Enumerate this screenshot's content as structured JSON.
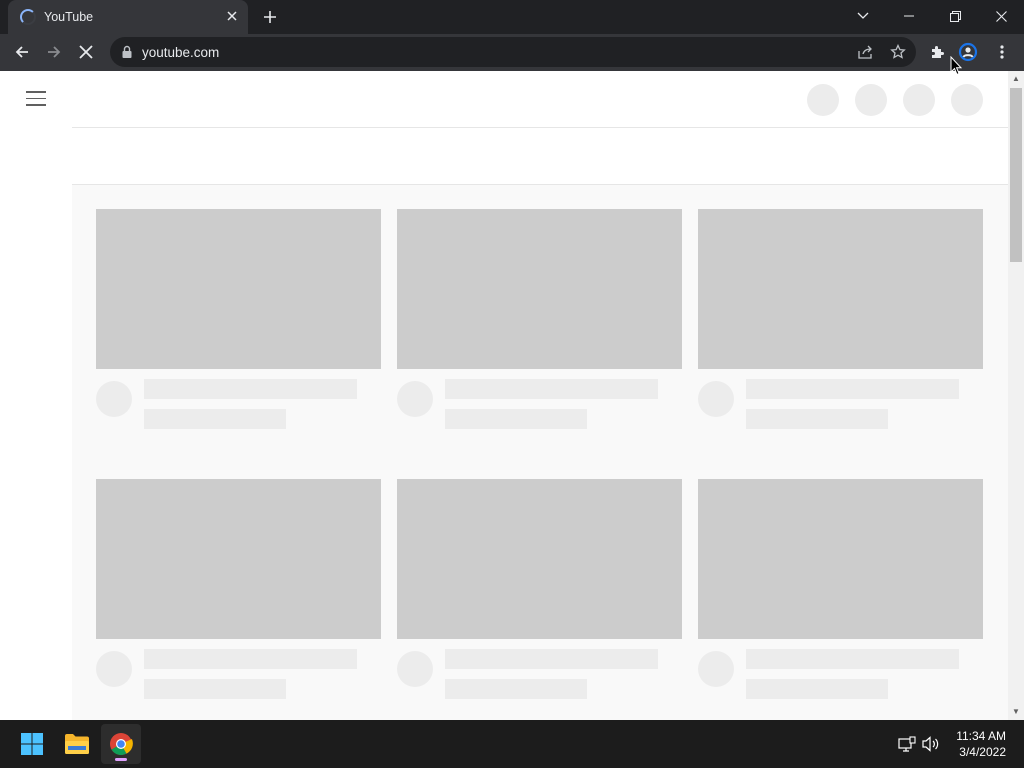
{
  "browser": {
    "tab": {
      "title": "YouTube",
      "close_icon": "close-icon",
      "loading_icon": "spinner-icon"
    },
    "new_tab_icon": "plus-icon",
    "window_controls": [
      "tab-search-icon",
      "minimize-icon",
      "restore-icon",
      "close-icon"
    ],
    "toolbar": {
      "back_icon": "arrow-left-icon",
      "forward_icon": "arrow-right-icon",
      "stop_icon": "close-icon",
      "url": "youtube.com",
      "lock_icon": "lock-icon",
      "share_icon": "share-icon",
      "bookmark_icon": "star-icon",
      "extensions_icon": "puzzle-icon",
      "profile_icon": "avatar-icon",
      "menu_icon": "kebab-menu-icon"
    }
  },
  "page": {
    "site": "YouTube",
    "state": "loading-skeleton",
    "header_placeholders": 4,
    "rows": [
      {
        "cards": 3
      },
      {
        "cards": 3
      }
    ]
  },
  "taskbar": {
    "apps": [
      {
        "name": "start",
        "icon": "windows-logo-icon"
      },
      {
        "name": "file-explorer",
        "icon": "folder-icon"
      },
      {
        "name": "chrome",
        "icon": "chrome-icon",
        "active": true
      }
    ],
    "tray": [
      "network-icon",
      "volume-icon"
    ],
    "time": "11:34 AM",
    "date": "3/4/2022"
  },
  "colors": {
    "chrome_dark": "#202124",
    "chrome_toolbar": "#35363a",
    "skeleton_thumb": "#cccccc",
    "skeleton_line": "#ececec",
    "content_bg": "#f9f9f9",
    "taskbar": "#1c1c1c"
  }
}
